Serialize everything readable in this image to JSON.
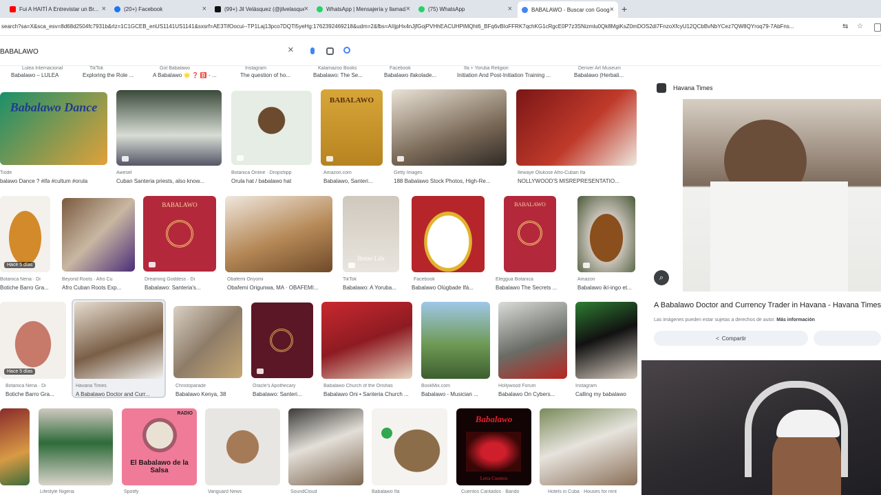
{
  "tabs": [
    {
      "title": "Fui A HAITÍ A Entrevistar un Br...",
      "favicon_color": "#ff0000",
      "active": false
    },
    {
      "title": "(20+) Facebook",
      "favicon_color": "#1877f2",
      "active": false
    },
    {
      "title": "(99+) Jil Velásquez (@jilvelasquez...",
      "favicon_color": "#111111",
      "active": false
    },
    {
      "title": "WhatsApp | Mensajería y llamad...",
      "favicon_color": "#25d366",
      "active": false
    },
    {
      "title": "(75) WhatsApp",
      "favicon_color": "#25d366",
      "active": false
    },
    {
      "title": "BABALAWO - Buscar con Google",
      "favicon_color": "#4285f4",
      "active": true
    }
  ],
  "address_bar": {
    "url": "search?sa=X&sca_esv=8d68d2504fc7931b&rlz=1C1GCEB_enUS1141US1141&sxsrf=AE3TifOocui--TP1Laj13pco7DQTl5yeHg:1762392469218&udm=2&fbs=AIIjpHx4nJjfGojPVHhEACUHPiMQht6_BFq6vBIoFFRK7qchKG1cRgcE0P7z3SNizmlu0Qk8MgiKsZ0mDOS2di7FnzoXfcyU12QCbBvNbYCez7QW8QYroq79-7AbFns..."
  },
  "search": {
    "query": "BABALAWO",
    "icons": [
      "clear-icon",
      "microphone-icon",
      "lens-icon",
      "search-icon"
    ]
  },
  "results_rows": [
    [
      {
        "source": "Lulea Internacional",
        "caption": "Babalawo – LULEA"
      },
      {
        "source": "TikTok",
        "caption": "Exploring the Role ..."
      },
      {
        "source": "Got Babalawo",
        "caption": "A Babalawo 🌟 ❓ 🅱️ - ..."
      },
      {
        "source": "Instagram",
        "caption": "The question of ho..."
      },
      {
        "source": "Kalamazoo Books",
        "caption": "Babalawo: The Se..."
      },
      {
        "source": "Facebook",
        "caption": "Babalawo ifakolade..."
      },
      {
        "source": "Ifa + Yoruba Religion",
        "caption": "Initiation And Post-Initiation Training ..."
      },
      {
        "source": "Denver Art Museum",
        "caption": "Babalawo (Herbali..."
      }
    ],
    [
      {
        "source": "Tiode",
        "caption": "balawo Dance ? #ifa #cultum #orula",
        "thumb_text": "Babalawo Dance"
      },
      {
        "source": "Awesel",
        "caption": "Cuban Santeria priests, also know..."
      },
      {
        "source": "Botanica Online · Dropshipp",
        "caption": "Orula hat / babalawo hat"
      },
      {
        "source": "Amazon.com",
        "caption": "Babalawo, Santeri...",
        "thumb_text": "BABALAWO"
      },
      {
        "source": "Getty Images",
        "caption": "188 Babalawo Stock Photos, High-Re..."
      },
      {
        "source": "Ilewaye Olukose Afro-Cuban Ifa",
        "caption": "NOLLYWOOD'S MISREPRESENTATIO..."
      }
    ],
    [
      {
        "source": "Botanica Nena · Di",
        "caption": "Botiche Barro Gra...",
        "badge": "Hace 5 días"
      },
      {
        "source": "Beyond Roots · Afro Cu",
        "caption": "Afro Cuban Roots Exp..."
      },
      {
        "source": "Dreaming Goddess · Di",
        "caption": "Babalawo: Santeria's...",
        "thumb_text": "BABALAWO"
      },
      {
        "source": "Obafemi Oriyomi",
        "caption": "Obafemi Origunwa, MA · OBAFEMI..."
      },
      {
        "source": "TikTok",
        "caption": "Babalawo: A Yoruba...",
        "thumb_text": "Better Life"
      },
      {
        "source": "Facebook",
        "caption": "Babalawo Olúgbade Ifá..."
      },
      {
        "source": "Eleggua Botanica",
        "caption": "Babalawo The Secrets ...",
        "thumb_text": "BABALAWO"
      },
      {
        "source": "Amazon",
        "caption": "Babalawo ikí-ingo et..."
      }
    ],
    [
      {
        "source": "Botanica Nena · Di",
        "caption": "Botiche Barro Gra...",
        "badge": "Hace 5 días"
      },
      {
        "source": "Havana Times",
        "caption": "A Babalawo Doctor and Curr..."
      },
      {
        "source": "Christoparade",
        "caption": "Babalawo Kenya, 38"
      },
      {
        "source": "Oracle's Apothecary",
        "caption": "Babalawo: Santeri..."
      },
      {
        "source": "Babalawo Church of the Orishas",
        "caption": "Babalawo Oni • Santeria Church ..."
      },
      {
        "source": "BookMix.com",
        "caption": "Babalawo - Musician ..."
      },
      {
        "source": "Hollywood Forum",
        "caption": "Babalawo On Cybers..."
      },
      {
        "source": "Instagram",
        "caption": "Calling my babalawo"
      }
    ],
    [
      {
        "source": "Lifestyle Nigeria",
        "caption": ""
      },
      {
        "source": "Spotify",
        "caption": "",
        "thumb_text": "El Babalawo de la Salsa",
        "thumb_label": "RADIO"
      },
      {
        "source": "Vanguard News",
        "caption": ""
      },
      {
        "source": "SoundCloud",
        "caption": ""
      },
      {
        "source": "Babalawo Ifa",
        "caption": ""
      },
      {
        "source": "Cuentos Cantados · Bando",
        "caption": "",
        "thumb_text": "Babalawo",
        "thumb_label": "Letra Cuentos"
      },
      {
        "source": "Hotels in Cuba · Houses for rent",
        "caption": ""
      }
    ]
  ],
  "side_panel": {
    "site": "Havana Times",
    "title": "A Babalawo Doctor and Currency Trader in Havana - Havana Times",
    "note": "Las imágenes pueden estar sujetas a derechos de autor.",
    "more_info": "Más información",
    "share_label": "Compartir"
  },
  "colors": {
    "tabbar_bg": "#dfe3ea",
    "link_accent": "#1a73e8"
  }
}
